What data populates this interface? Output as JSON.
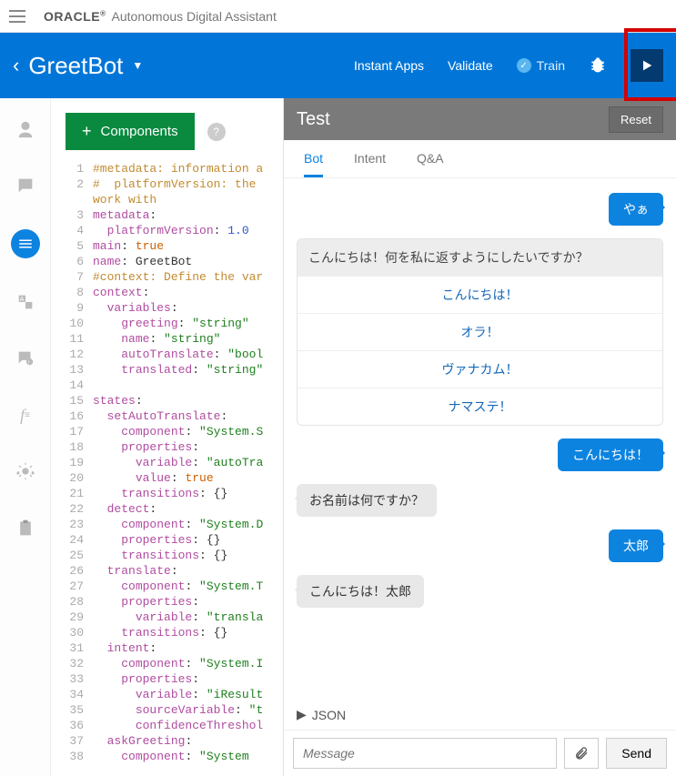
{
  "brand": {
    "oracle": "ORACLE",
    "reg": "®",
    "product": "Autonomous Digital Assistant"
  },
  "header": {
    "title": "GreetBot",
    "links": {
      "instant_apps": "Instant Apps",
      "validate": "Validate",
      "train": "Train"
    }
  },
  "leftnav": {
    "items": [
      {
        "name": "persona-icon"
      },
      {
        "name": "chat-icon"
      },
      {
        "name": "flow-icon",
        "active": true
      },
      {
        "name": "language-icon"
      },
      {
        "name": "qa-icon"
      },
      {
        "name": "function-icon"
      },
      {
        "name": "settings-icon"
      },
      {
        "name": "clipboard-icon"
      }
    ]
  },
  "codebar": {
    "components": "Components"
  },
  "code_lines": [
    {
      "n": 1,
      "cls": "c-comment",
      "t": "#metadata: information a"
    },
    {
      "n": 2,
      "cls": "c-comment",
      "t": "#  platformVersion: the "
    },
    {
      "n": 0,
      "cls": "c-comment",
      "t": "work with"
    },
    {
      "n": 3,
      "cls": "ln",
      "t": "<k>metadata</k>:"
    },
    {
      "n": 4,
      "cls": "ln",
      "t": "  <k>platformVersion</k>: <n>1.0</n>"
    },
    {
      "n": 5,
      "cls": "ln",
      "t": "<k>main</k>: <b>true</b>"
    },
    {
      "n": 6,
      "cls": "ln",
      "t": "<k>name</k>: GreetBot"
    },
    {
      "n": 7,
      "cls": "c-comment",
      "t": "#context: Define the var"
    },
    {
      "n": 8,
      "cls": "ln",
      "t": "<k>context</k>:"
    },
    {
      "n": 9,
      "cls": "ln",
      "t": "  <k>variables</k>:"
    },
    {
      "n": 10,
      "cls": "ln",
      "t": "    <k>greeting</k>: <s>\"string\"</s>"
    },
    {
      "n": 11,
      "cls": "ln",
      "t": "    <k>name</k>: <s>\"string\"</s>"
    },
    {
      "n": 12,
      "cls": "ln",
      "t": "    <k>autoTranslate</k>: <s>\"bool</s>"
    },
    {
      "n": 13,
      "cls": "ln",
      "t": "    <k>translated</k>: <s>\"string\"</s>"
    },
    {
      "n": 14,
      "cls": "ln",
      "t": ""
    },
    {
      "n": 15,
      "cls": "ln",
      "t": "<k>states</k>:"
    },
    {
      "n": 16,
      "cls": "ln",
      "t": "  <k>setAutoTranslate</k>:"
    },
    {
      "n": 17,
      "cls": "ln",
      "t": "    <k>component</k>: <s>\"System.S</s>"
    },
    {
      "n": 18,
      "cls": "ln",
      "t": "    <k>properties</k>:"
    },
    {
      "n": 19,
      "cls": "ln",
      "t": "      <k>variable</k>: <s>\"autoTra</s>"
    },
    {
      "n": 20,
      "cls": "ln",
      "t": "      <k>value</k>: <b>true</b>"
    },
    {
      "n": 21,
      "cls": "ln",
      "t": "    <k>transitions</k>: {}"
    },
    {
      "n": 22,
      "cls": "ln",
      "t": "  <k>detect</k>:"
    },
    {
      "n": 23,
      "cls": "ln",
      "t": "    <k>component</k>: <s>\"System.D</s>"
    },
    {
      "n": 24,
      "cls": "ln",
      "t": "    <k>properties</k>: {}"
    },
    {
      "n": 25,
      "cls": "ln",
      "t": "    <k>transitions</k>: {}"
    },
    {
      "n": 26,
      "cls": "ln",
      "t": "  <k>translate</k>:"
    },
    {
      "n": 27,
      "cls": "ln",
      "t": "    <k>component</k>: <s>\"System.T</s>"
    },
    {
      "n": 28,
      "cls": "ln",
      "t": "    <k>properties</k>:"
    },
    {
      "n": 29,
      "cls": "ln",
      "t": "      <k>variable</k>: <s>\"transla</s>"
    },
    {
      "n": 30,
      "cls": "ln",
      "t": "    <k>transitions</k>: {}"
    },
    {
      "n": 31,
      "cls": "ln",
      "t": "  <k>intent</k>:"
    },
    {
      "n": 32,
      "cls": "ln",
      "t": "    <k>component</k>: <s>\"System.I</s>"
    },
    {
      "n": 33,
      "cls": "ln",
      "t": "    <k>properties</k>:"
    },
    {
      "n": 34,
      "cls": "ln",
      "t": "      <k>variable</k>: <s>\"iResult</s>"
    },
    {
      "n": 35,
      "cls": "ln",
      "t": "      <k>sourceVariable</k>: <s>\"t</s>"
    },
    {
      "n": 36,
      "cls": "ln",
      "t": "      <k>confidenceThreshol</k>"
    },
    {
      "n": 37,
      "cls": "ln",
      "t": "  <k>askGreeting</k>:"
    },
    {
      "n": 38,
      "cls": "ln",
      "t": "    <k>component</k>: <s>\"System </s>"
    }
  ],
  "test": {
    "title": "Test",
    "reset": "Reset",
    "tabs": {
      "bot": "Bot",
      "intent": "Intent",
      "qa": "Q&A"
    },
    "chat": {
      "u1": "やぁ",
      "prompt1": "こんにちは！何を私に返すようにしたいですか？",
      "opt1": "こんにちは！",
      "opt2": "オラ！",
      "opt3": "ヴァナカム！",
      "opt4": "ナマステ！",
      "u2": "こんにちは！",
      "b2": "お名前は何ですか？",
      "u3": "太郎",
      "b3": "こんにちは！太郎"
    },
    "json_toggle": "JSON",
    "input_placeholder": "Message",
    "send": "Send"
  }
}
